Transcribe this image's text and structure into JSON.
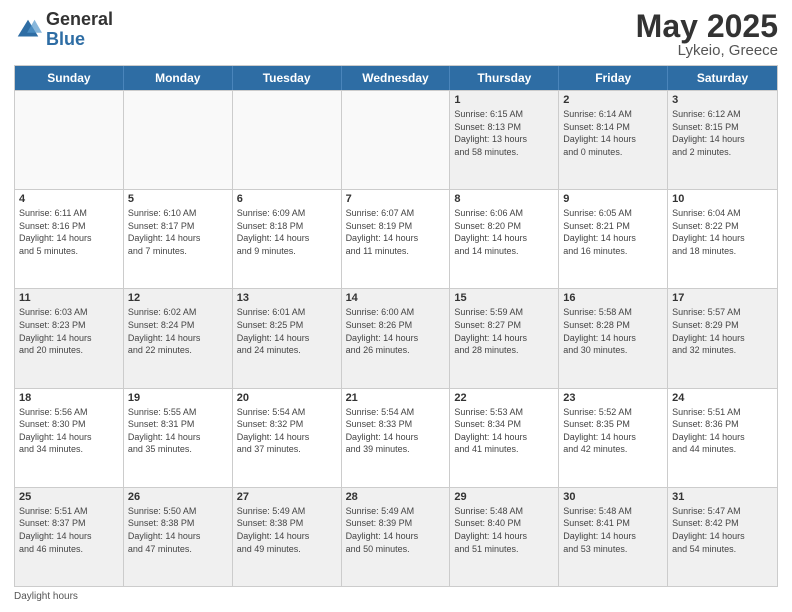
{
  "header": {
    "logo_general": "General",
    "logo_blue": "Blue",
    "title": "May 2025",
    "location": "Lykeio, Greece"
  },
  "days_of_week": [
    "Sunday",
    "Monday",
    "Tuesday",
    "Wednesday",
    "Thursday",
    "Friday",
    "Saturday"
  ],
  "footer": "Daylight hours",
  "weeks": [
    [
      {
        "num": "",
        "detail": "",
        "empty": true
      },
      {
        "num": "",
        "detail": "",
        "empty": true
      },
      {
        "num": "",
        "detail": "",
        "empty": true
      },
      {
        "num": "",
        "detail": "",
        "empty": true
      },
      {
        "num": "1",
        "detail": "Sunrise: 6:15 AM\nSunset: 8:13 PM\nDaylight: 13 hours\nand 58 minutes."
      },
      {
        "num": "2",
        "detail": "Sunrise: 6:14 AM\nSunset: 8:14 PM\nDaylight: 14 hours\nand 0 minutes."
      },
      {
        "num": "3",
        "detail": "Sunrise: 6:12 AM\nSunset: 8:15 PM\nDaylight: 14 hours\nand 2 minutes."
      }
    ],
    [
      {
        "num": "4",
        "detail": "Sunrise: 6:11 AM\nSunset: 8:16 PM\nDaylight: 14 hours\nand 5 minutes."
      },
      {
        "num": "5",
        "detail": "Sunrise: 6:10 AM\nSunset: 8:17 PM\nDaylight: 14 hours\nand 7 minutes."
      },
      {
        "num": "6",
        "detail": "Sunrise: 6:09 AM\nSunset: 8:18 PM\nDaylight: 14 hours\nand 9 minutes."
      },
      {
        "num": "7",
        "detail": "Sunrise: 6:07 AM\nSunset: 8:19 PM\nDaylight: 14 hours\nand 11 minutes."
      },
      {
        "num": "8",
        "detail": "Sunrise: 6:06 AM\nSunset: 8:20 PM\nDaylight: 14 hours\nand 14 minutes."
      },
      {
        "num": "9",
        "detail": "Sunrise: 6:05 AM\nSunset: 8:21 PM\nDaylight: 14 hours\nand 16 minutes."
      },
      {
        "num": "10",
        "detail": "Sunrise: 6:04 AM\nSunset: 8:22 PM\nDaylight: 14 hours\nand 18 minutes."
      }
    ],
    [
      {
        "num": "11",
        "detail": "Sunrise: 6:03 AM\nSunset: 8:23 PM\nDaylight: 14 hours\nand 20 minutes."
      },
      {
        "num": "12",
        "detail": "Sunrise: 6:02 AM\nSunset: 8:24 PM\nDaylight: 14 hours\nand 22 minutes."
      },
      {
        "num": "13",
        "detail": "Sunrise: 6:01 AM\nSunset: 8:25 PM\nDaylight: 14 hours\nand 24 minutes."
      },
      {
        "num": "14",
        "detail": "Sunrise: 6:00 AM\nSunset: 8:26 PM\nDaylight: 14 hours\nand 26 minutes."
      },
      {
        "num": "15",
        "detail": "Sunrise: 5:59 AM\nSunset: 8:27 PM\nDaylight: 14 hours\nand 28 minutes."
      },
      {
        "num": "16",
        "detail": "Sunrise: 5:58 AM\nSunset: 8:28 PM\nDaylight: 14 hours\nand 30 minutes."
      },
      {
        "num": "17",
        "detail": "Sunrise: 5:57 AM\nSunset: 8:29 PM\nDaylight: 14 hours\nand 32 minutes."
      }
    ],
    [
      {
        "num": "18",
        "detail": "Sunrise: 5:56 AM\nSunset: 8:30 PM\nDaylight: 14 hours\nand 34 minutes."
      },
      {
        "num": "19",
        "detail": "Sunrise: 5:55 AM\nSunset: 8:31 PM\nDaylight: 14 hours\nand 35 minutes."
      },
      {
        "num": "20",
        "detail": "Sunrise: 5:54 AM\nSunset: 8:32 PM\nDaylight: 14 hours\nand 37 minutes."
      },
      {
        "num": "21",
        "detail": "Sunrise: 5:54 AM\nSunset: 8:33 PM\nDaylight: 14 hours\nand 39 minutes."
      },
      {
        "num": "22",
        "detail": "Sunrise: 5:53 AM\nSunset: 8:34 PM\nDaylight: 14 hours\nand 41 minutes."
      },
      {
        "num": "23",
        "detail": "Sunrise: 5:52 AM\nSunset: 8:35 PM\nDaylight: 14 hours\nand 42 minutes."
      },
      {
        "num": "24",
        "detail": "Sunrise: 5:51 AM\nSunset: 8:36 PM\nDaylight: 14 hours\nand 44 minutes."
      }
    ],
    [
      {
        "num": "25",
        "detail": "Sunrise: 5:51 AM\nSunset: 8:37 PM\nDaylight: 14 hours\nand 46 minutes."
      },
      {
        "num": "26",
        "detail": "Sunrise: 5:50 AM\nSunset: 8:38 PM\nDaylight: 14 hours\nand 47 minutes."
      },
      {
        "num": "27",
        "detail": "Sunrise: 5:49 AM\nSunset: 8:38 PM\nDaylight: 14 hours\nand 49 minutes."
      },
      {
        "num": "28",
        "detail": "Sunrise: 5:49 AM\nSunset: 8:39 PM\nDaylight: 14 hours\nand 50 minutes."
      },
      {
        "num": "29",
        "detail": "Sunrise: 5:48 AM\nSunset: 8:40 PM\nDaylight: 14 hours\nand 51 minutes."
      },
      {
        "num": "30",
        "detail": "Sunrise: 5:48 AM\nSunset: 8:41 PM\nDaylight: 14 hours\nand 53 minutes."
      },
      {
        "num": "31",
        "detail": "Sunrise: 5:47 AM\nSunset: 8:42 PM\nDaylight: 14 hours\nand 54 minutes."
      }
    ]
  ]
}
